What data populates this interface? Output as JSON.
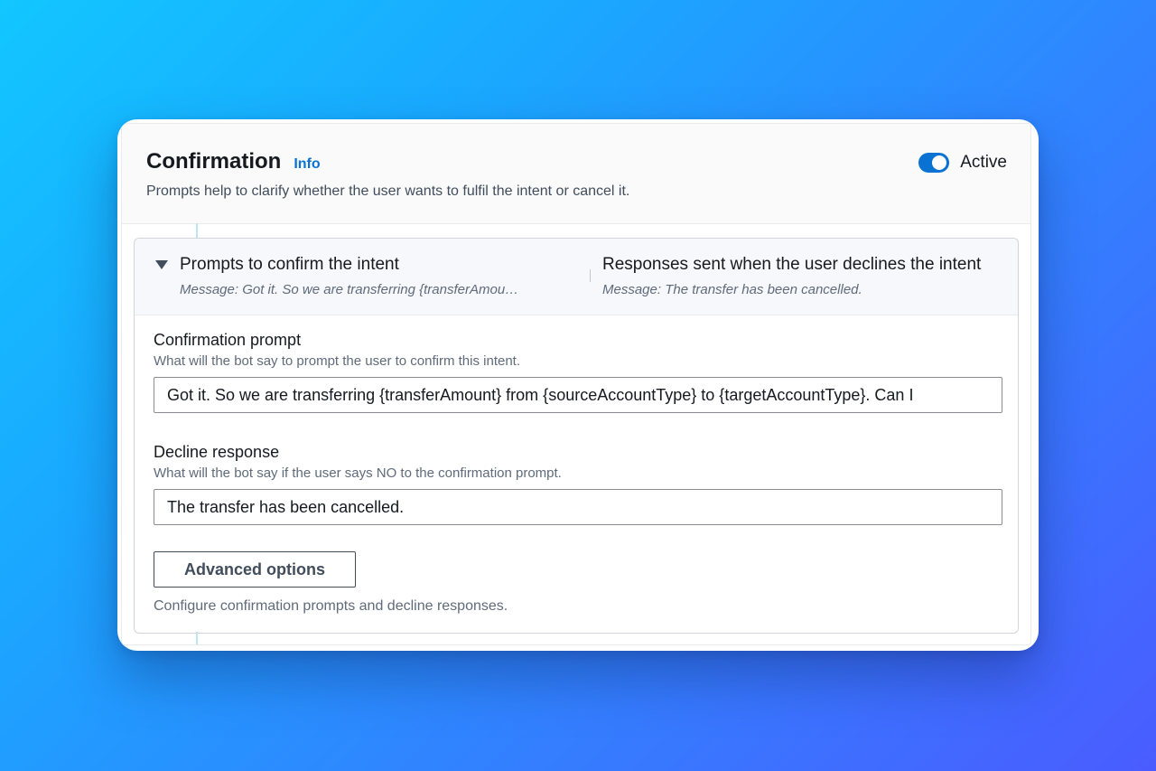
{
  "colors": {
    "accent": "#0972d3",
    "text_primary": "#16191f",
    "text_secondary": "#5f6b7a",
    "background_gradient_start": "#12c6ff",
    "background_gradient_end": "#4a5cff"
  },
  "header": {
    "title": "Confirmation",
    "info_link": "Info",
    "description": "Prompts help to clarify whether the user wants to fulfil the intent or cancel it.",
    "toggle": {
      "label": "Active",
      "state": "on"
    }
  },
  "panel": {
    "expanded": true,
    "left": {
      "title": "Prompts to confirm the intent",
      "message": "Message: Got it. So we are transferring {transferAmou…"
    },
    "right": {
      "title": "Responses sent when the user declines the intent",
      "message": "Message: The transfer has been cancelled."
    }
  },
  "fields": {
    "confirmation_prompt": {
      "label": "Confirmation prompt",
      "description": "What will the bot say to prompt the user to confirm this intent.",
      "value": "Got it. So we are transferring {transferAmount} from {sourceAccountType} to {targetAccountType}. Can I"
    },
    "decline_response": {
      "label": "Decline response",
      "description": "What will the bot say if the user says NO to the confirmation prompt.",
      "value": "The transfer has been cancelled."
    }
  },
  "advanced": {
    "button_label": "Advanced options",
    "description": "Configure confirmation prompts and decline responses."
  }
}
